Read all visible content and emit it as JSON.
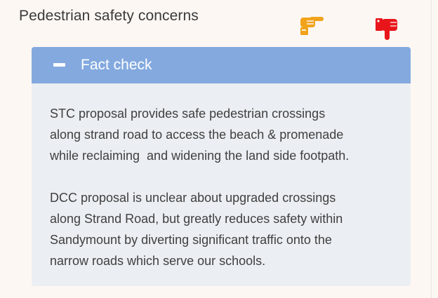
{
  "card": {
    "title": "Pedestrian safety concerns",
    "icons": [
      "thumbs-sideways-icon",
      "thumbs-down-icon"
    ]
  },
  "accordion": {
    "header_label": "Fact check",
    "toggle_icon": "minus-icon",
    "paragraphs": [
      "STC proposal provides safe pedestrian crossings\nalong strand road to access the beach & promenade\nwhile reclaiming  and widening the land side footpath.",
      "DCC proposal is unclear about upgraded crossings\nalong Strand Road, but greatly reduces safety within\nSandymount by diverting significant traffic onto the\nnarrow roads which serve our schools."
    ]
  },
  "colors": {
    "background": "#fdf7f3",
    "header_bg": "#83a9df",
    "body_bg": "#ebeff3",
    "thumb_sideways": "#f0a31b",
    "thumb_down": "#e8151b"
  }
}
